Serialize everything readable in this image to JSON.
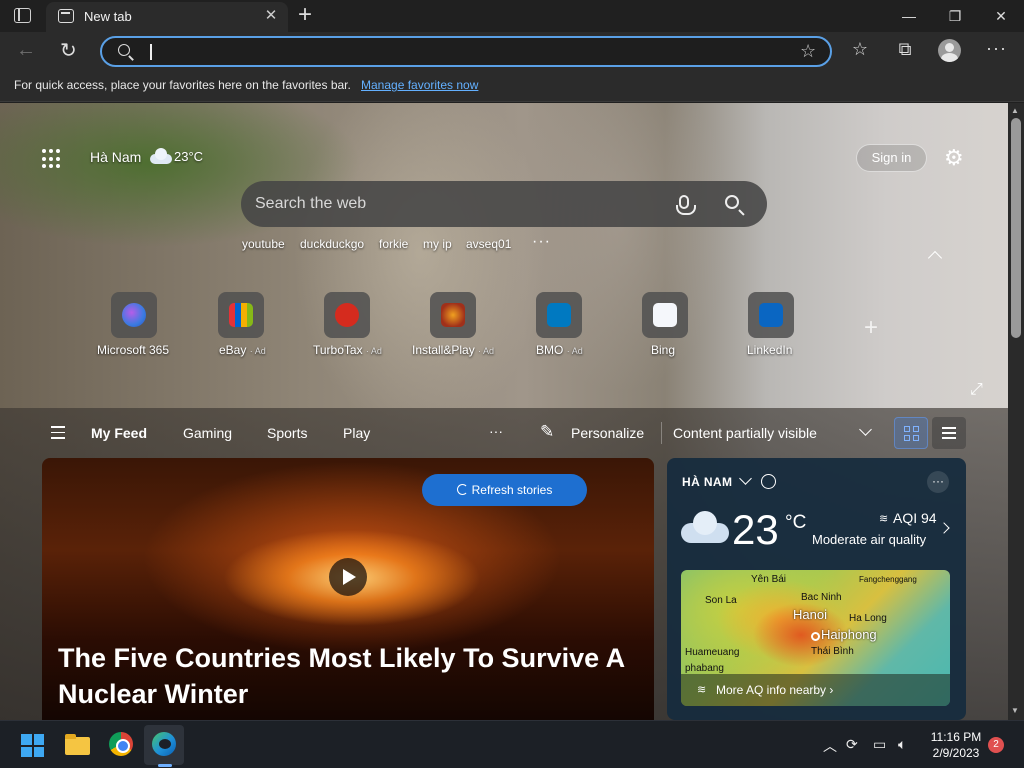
{
  "browser": {
    "tab_title": "New tab",
    "address_placeholder": "",
    "favbar_text": "For quick access, place your favorites here on the favorites bar.",
    "favbar_link": "Manage favorites now"
  },
  "header": {
    "location": "Hà Nam",
    "temperature": "23°C",
    "sign_in": "Sign in"
  },
  "search": {
    "placeholder": "Search the web",
    "quick_links": [
      "youtube",
      "duckduckgo",
      "forkie",
      "my ip",
      "avseq01"
    ]
  },
  "tiles": [
    {
      "label": "Microsoft 365",
      "ad": ""
    },
    {
      "label": "eBay",
      "ad": "· Ad"
    },
    {
      "label": "TurboTax",
      "ad": "· Ad"
    },
    {
      "label": "Install&Play",
      "ad": "· Ad"
    },
    {
      "label": "BMO",
      "ad": "· Ad"
    },
    {
      "label": "Bing",
      "ad": ""
    },
    {
      "label": "LinkedIn",
      "ad": ""
    }
  ],
  "feed": {
    "tabs": [
      "My Feed",
      "Gaming",
      "Sports",
      "Play"
    ],
    "personalize": "Personalize",
    "content_visibility": "Content partially visible",
    "refresh": "Refresh stories",
    "hero_title": "The Five Countries Most Likely To Survive A Nuclear Winter"
  },
  "weather": {
    "location": "HÀ NAM",
    "temp": "23",
    "unit": "°C",
    "aqi": "AQI 94",
    "aqi_desc": "Moderate air quality",
    "map_labels": [
      "Yên Bái",
      "Fangchenggang",
      "Son La",
      "Bac Ninh",
      "Hanoi",
      "Ha Long",
      "Haiphong",
      "Huameuang",
      "Thái Bình",
      "phabang"
    ],
    "map_link": "More AQ info nearby"
  },
  "taskbar": {
    "time": "11:16 PM",
    "date": "2/9/2023",
    "notifications": "2"
  },
  "colors": {
    "accent": "#5aa0e6",
    "refresh_button": "#1e6fd0",
    "favbar_link": "#63b0ff",
    "windows_logo": "#3ea8f2"
  }
}
